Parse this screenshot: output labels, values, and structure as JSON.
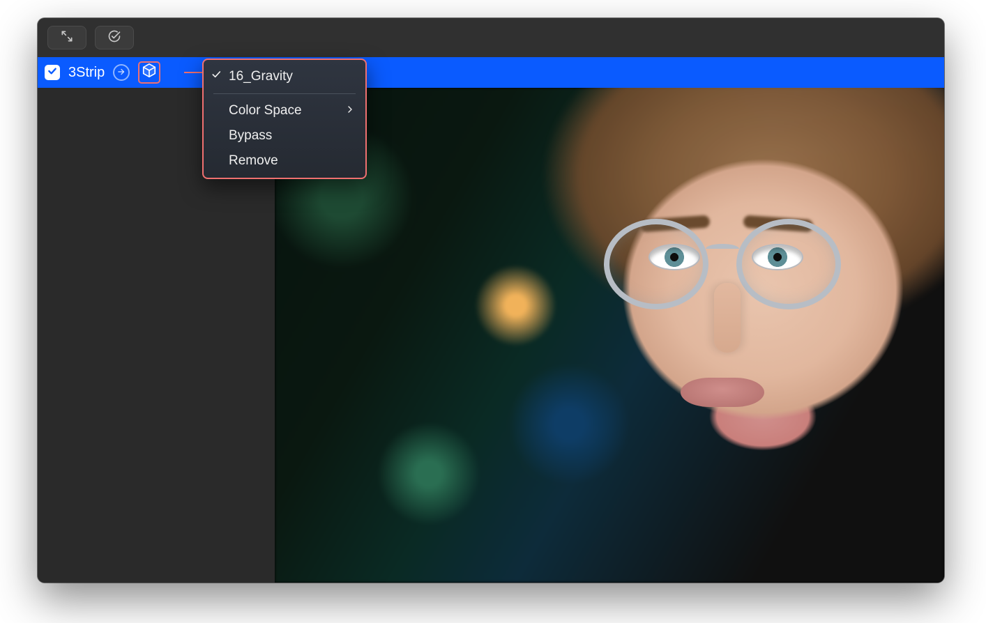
{
  "header": {
    "filter_name": "3Strip"
  },
  "menu": {
    "current_lut": "16_Gravity",
    "items": {
      "color_space": "Color Space",
      "bypass": "Bypass",
      "remove": "Remove"
    }
  },
  "icons": {
    "expand": "expand-arrows-icon",
    "check_circle": "check-circle-icon",
    "checkbox": "checkbox-checked-icon",
    "arrow_next": "arrow-circle-right-icon",
    "cube": "cube-icon",
    "checkmark": "checkmark-icon",
    "chevron_right": "chevron-right-icon"
  },
  "colors": {
    "header_bg": "#0a5bff",
    "annotation": "#f07070",
    "window_bg": "#2a2a2a"
  }
}
